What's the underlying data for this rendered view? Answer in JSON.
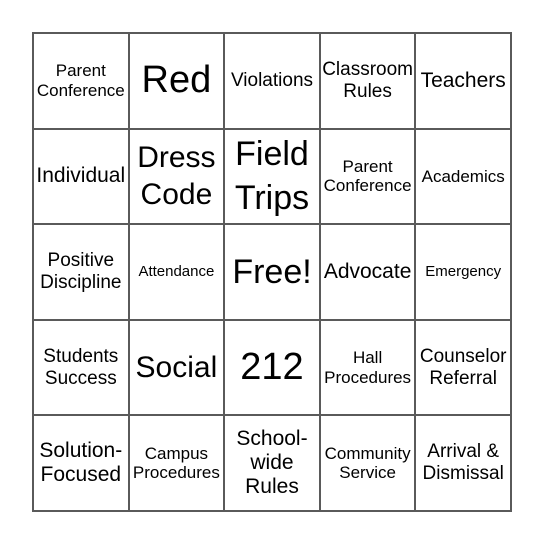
{
  "card": {
    "rows": [
      [
        "Parent\nConference",
        "Red",
        "Violations",
        "Classroom\nRules",
        "Teachers"
      ],
      [
        "Individual",
        "Dress\nCode",
        "Field\nTrips",
        "Parent\nConference",
        "Academics"
      ],
      [
        "Positive\nDiscipline",
        "Attendance",
        "Free!",
        "Advocate",
        "Emergency"
      ],
      [
        "Students\nSuccess",
        "Social",
        "212",
        "Hall\nProcedures",
        "Counselor\nReferral"
      ],
      [
        "Solution-\nFocused",
        "Campus\nProcedures",
        "School-\nwide\nRules",
        "Community\nService",
        "Arrival &\nDismissal"
      ]
    ]
  }
}
